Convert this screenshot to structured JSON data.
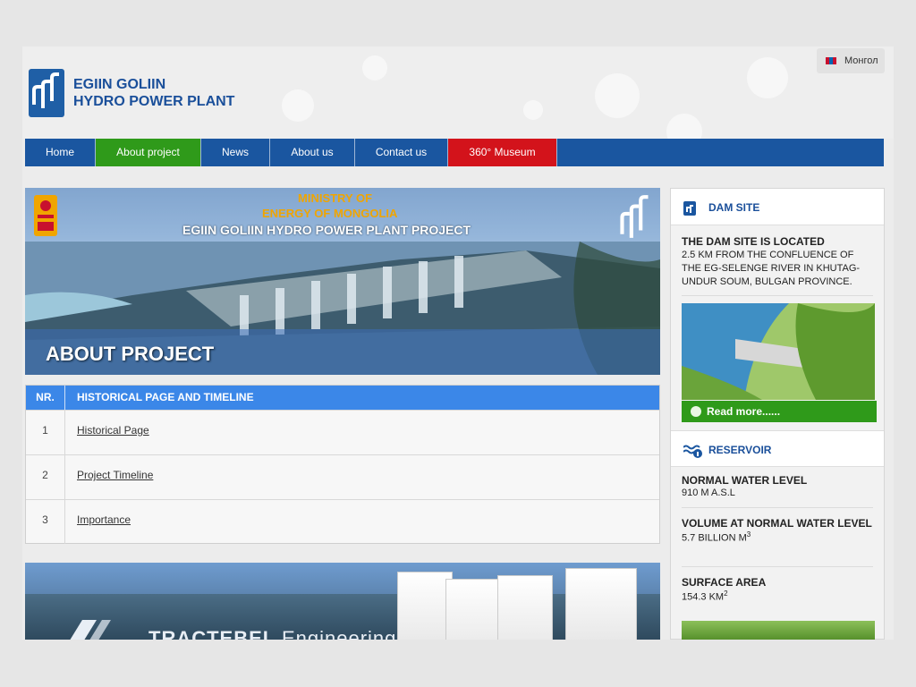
{
  "header": {
    "brand_line1": "EGIIN GOLIIN",
    "brand_line2": "HYDRO POWER PLANT",
    "language": "Монгол"
  },
  "nav": {
    "items": [
      {
        "label": "Home"
      },
      {
        "label": "About project"
      },
      {
        "label": "News"
      },
      {
        "label": "About us"
      },
      {
        "label": "Contact us"
      },
      {
        "label": "360° Museum"
      }
    ],
    "active": "About project"
  },
  "banner": {
    "ministry_line1": "MINISTRY OF",
    "ministry_line2": "ENERGY OF MONGOLIA",
    "project_title": "EGIIN GOLIIN HYDRO POWER PLANT PROJECT",
    "page_title": "ABOUT PROJECT"
  },
  "table": {
    "col_nr": "NR.",
    "col_title": "HISTORICAL PAGE AND TIMELINE",
    "rows": [
      {
        "nr": "1",
        "title": "Historical Page"
      },
      {
        "nr": "2",
        "title": "Project Timeline"
      },
      {
        "nr": "3",
        "title": "Importance"
      }
    ]
  },
  "promo": {
    "brand": "TRACTEBEL",
    "brand_suffix": "Engineering"
  },
  "sidebar": {
    "dam": {
      "heading": "DAM SITE",
      "title": "THE DAM SITE IS LOCATED",
      "text": "2.5 KM FROM THE CONFLUENCE OF THE EG-SELENGE RIVER IN KHUTAG-UNDUR SOUM, BULGAN PROVINCE.",
      "read_more": "Read more......"
    },
    "reservoir": {
      "heading": "RESERVOIR",
      "stats": [
        {
          "label": "NORMAL WATER LEVEL",
          "value": "910 M A.S.L",
          "sup": ""
        },
        {
          "label": "VOLUME AT NORMAL WATER LEVEL",
          "value": "5.7 BILLION M",
          "sup": "3"
        },
        {
          "label": "SURFACE AREA",
          "value": "154.3 KM",
          "sup": "2"
        }
      ]
    }
  },
  "colors": {
    "nav_blue": "#1a56a0",
    "active_green": "#2f9a1a",
    "museum_red": "#d3131b",
    "table_header": "#3b87e8",
    "brand_blue": "#1a4f9a",
    "ministry_gold": "#f0a500"
  }
}
